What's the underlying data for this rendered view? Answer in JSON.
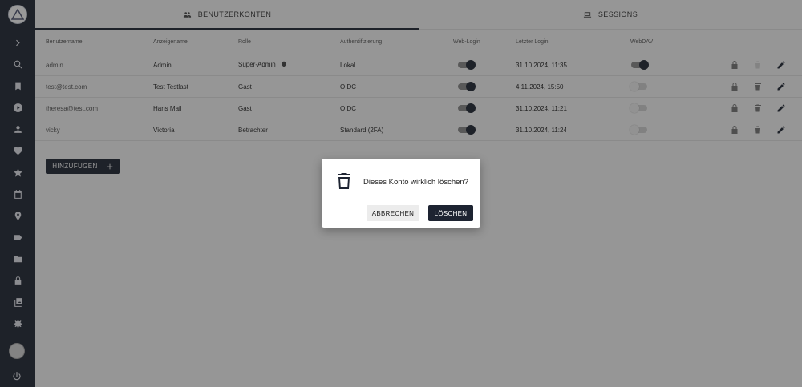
{
  "tabs": [
    {
      "label": "BENUTZERKONTEN",
      "icon": "people-icon"
    },
    {
      "label": "SESSIONS",
      "icon": "laptop-icon"
    }
  ],
  "table": {
    "headers": [
      "Benutzername",
      "Anzeigename",
      "Rolle",
      "Authentifizierung",
      "Web-Login",
      "Letzter Login",
      "WebDAV"
    ],
    "rows": [
      {
        "username": "admin",
        "display": "Admin",
        "role": "Super-Admin",
        "auth": "Lokal",
        "web_login": true,
        "last_login": "31.10.2024, 11:35",
        "webdav": true
      },
      {
        "username": "test@test.com",
        "display": "Test Testlast",
        "role": "Gast",
        "auth": "OIDC",
        "web_login": true,
        "last_login": "4.11.2024, 15:50",
        "webdav": false
      },
      {
        "username": "theresa@test.com",
        "display": "Hans Mail",
        "role": "Gast",
        "auth": "OIDC",
        "web_login": true,
        "last_login": "31.10.2024, 11:21",
        "webdav": false
      },
      {
        "username": "vicky",
        "display": "Victoria",
        "role": "Betrachter",
        "auth": "Standard (2FA)",
        "web_login": true,
        "last_login": "31.10.2024, 11:24",
        "webdav": false
      }
    ]
  },
  "add_button": {
    "label": "HINZUFÜGEN"
  },
  "dialog": {
    "message": "Dieses Konto wirklich löschen?",
    "cancel_label": "ABBRECHEN",
    "confirm_label": "LÖSCHEN"
  },
  "colors": {
    "primary": "#1d2331",
    "overlay": "#212121"
  }
}
